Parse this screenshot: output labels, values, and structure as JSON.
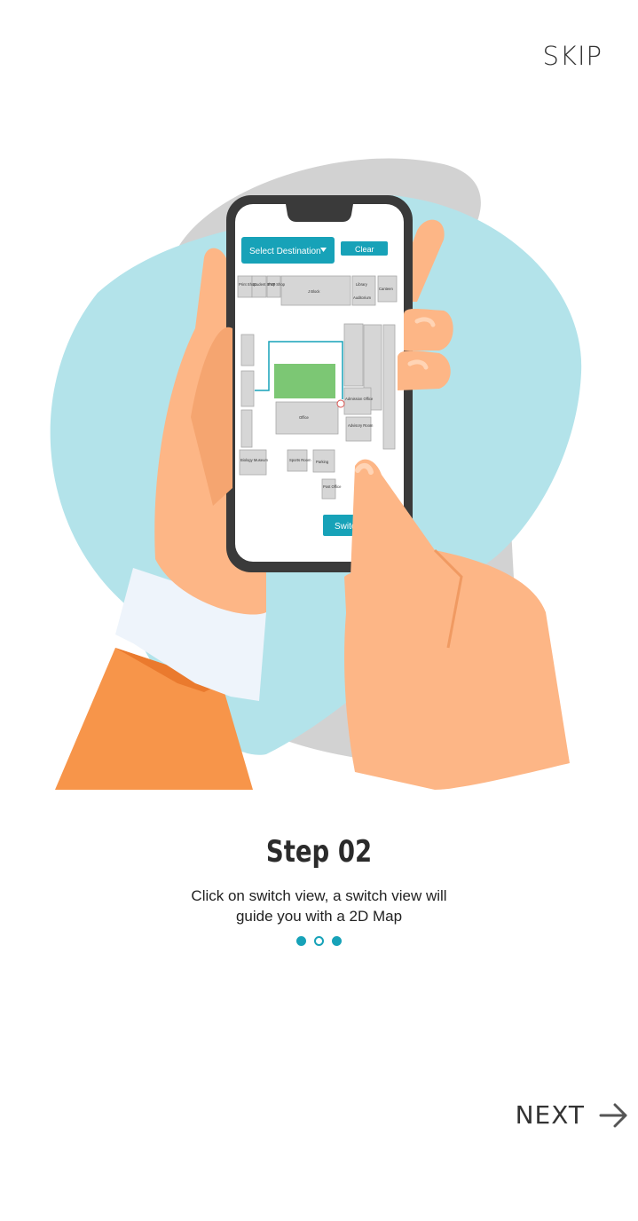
{
  "header": {
    "skip_label": "SKIP"
  },
  "phone_screen": {
    "select_destination": "Select Destination",
    "clear_label": "Clear",
    "switch_view_label": "Switch View",
    "map_labels": {
      "print_shop": "Print Shop",
      "student_shop": "Student Shop",
      "fyp_shop": "FYP Shop",
      "block": "J Block",
      "library": "Library",
      "auditorium": "Auditorium",
      "canteen": "Canteen",
      "office": "Office",
      "admission_office": "Admission Office",
      "advisory_room": "Advisory Room",
      "biology_museum": "Biology Museum",
      "sports_room": "Sports Room",
      "parking": "Parking",
      "post_office": "Post Office"
    }
  },
  "step": {
    "title": "Step 02",
    "description_line1": "Click on switch view, a switch view will",
    "description_line2": "guide you with a 2D Map"
  },
  "pagination": {
    "total": 3,
    "active_index": 1
  },
  "footer": {
    "next_label": "NEXT"
  },
  "colors": {
    "accent": "#17a2b8",
    "skin": "#fdb686",
    "blob_blue": "#b3e3ea",
    "blob_grey": "#cfcfcf",
    "sleeve": "#f7954a"
  }
}
